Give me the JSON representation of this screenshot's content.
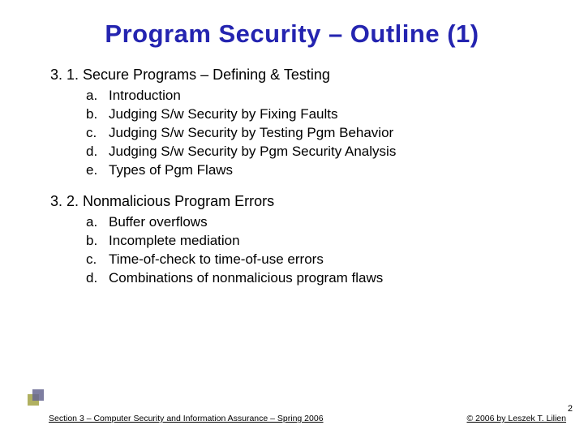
{
  "title": "Program Security – Outline (1)",
  "sections": [
    {
      "heading": "3. 1. Secure Programs – Defining & Testing",
      "items": [
        {
          "marker": "a.",
          "text": "Introduction"
        },
        {
          "marker": "b.",
          "text": "Judging S/w Security by Fixing Faults"
        },
        {
          "marker": "c.",
          "text": "Judging S/w Security by Testing Pgm Behavior"
        },
        {
          "marker": "d.",
          "text": "Judging S/w Security by Pgm Security Analysis"
        },
        {
          "marker": "e.",
          "text": "Types of Pgm Flaws"
        }
      ]
    },
    {
      "heading": "3. 2. Nonmalicious Program Errors",
      "items": [
        {
          "marker": "a.",
          "text": "Buffer overflows"
        },
        {
          "marker": "b.",
          "text": "Incomplete mediation"
        },
        {
          "marker": "c.",
          "text": "Time-of-check to time-of-use errors"
        },
        {
          "marker": "d.",
          "text": "Combinations of nonmalicious program flaws"
        }
      ]
    }
  ],
  "footer": {
    "left": "Section 3 – Computer Security and Information Assurance – Spring 2006",
    "right": "© 2006 by Leszek T. Lilien"
  },
  "page_number": "2"
}
